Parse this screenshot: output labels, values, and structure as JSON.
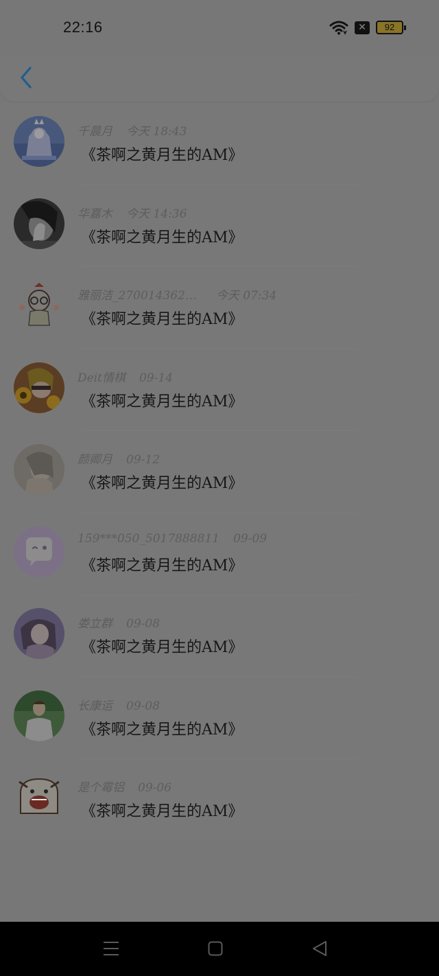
{
  "status_bar": {
    "time": "22:16",
    "battery": "92",
    "icons": [
      "wifi-icon",
      "close-box-icon",
      "battery-icon"
    ]
  },
  "header": {
    "back_icon": "chevron-left-icon"
  },
  "items": [
    {
      "name": "千晨月",
      "time": "今天 18:43",
      "message": "《茶啊之黄月生的AM》"
    },
    {
      "name": "华嘉木",
      "time": "今天 14:36",
      "message": "《茶啊之黄月生的AM》"
    },
    {
      "name": "雅丽洁_270014362…",
      "time": "今天 07:34",
      "message": "《茶啊之黄月生的AM》"
    },
    {
      "name": "Deit情棋",
      "time": "09-14",
      "message": "《茶啊之黄月生的AM》"
    },
    {
      "name": "颜卿月",
      "time": "09-12",
      "message": "《茶啊之黄月生的AM》"
    },
    {
      "name": "159***050_5017888811",
      "time": "09-09",
      "message": "《茶啊之黄月生的AM》"
    },
    {
      "name": "娄立群",
      "time": "09-08",
      "message": "《茶啊之黄月生的AM》"
    },
    {
      "name": "长康运",
      "time": "09-08",
      "message": "《茶啊之黄月生的AM》"
    },
    {
      "name": "是个霉铝",
      "time": "09-06",
      "message": "《茶啊之黄月生的AM》"
    }
  ],
  "navbar": {
    "icons": [
      "menu-icon",
      "home-square-icon",
      "back-triangle-icon"
    ]
  }
}
